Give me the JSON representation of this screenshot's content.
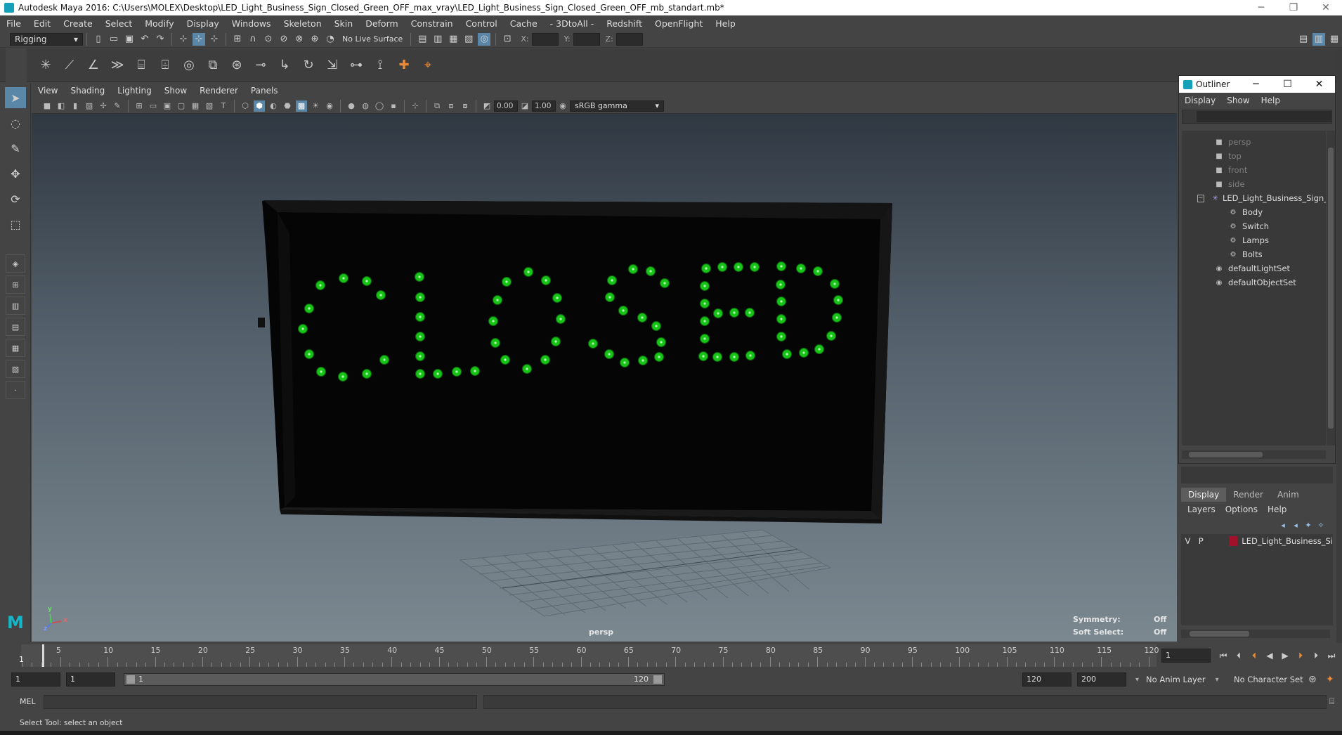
{
  "window": {
    "title": "Autodesk Maya 2016: C:\\Users\\MOLEX\\Desktop\\LED_Light_Business_Sign_Closed_Green_OFF_max_vray\\LED_Light_Business_Sign_Closed_Green_OFF_mb_standart.mb*",
    "minimize": "─",
    "restore": "❐",
    "close": "✕"
  },
  "menubar": [
    "File",
    "Edit",
    "Create",
    "Select",
    "Modify",
    "Display",
    "Windows",
    "Skeleton",
    "Skin",
    "Deform",
    "Constrain",
    "Control",
    "Cache",
    "- 3DtoAll -",
    "Redshift",
    "OpenFlight",
    "Help"
  ],
  "statusline": {
    "menuset": "Rigging",
    "live_surface": "No Live Surface",
    "x_label": "X:",
    "y_label": "Y:",
    "z_label": "Z:"
  },
  "panel": {
    "menus": [
      "View",
      "Shading",
      "Lighting",
      "Show",
      "Renderer",
      "Panels"
    ],
    "exposure": "0.00",
    "gamma": "1.00",
    "color_space": "sRGB gamma"
  },
  "viewport": {
    "camera_label": "persp",
    "symmetry_label": "Symmetry:",
    "symmetry_value": "Off",
    "soft_select_label": "Soft Select:",
    "soft_select_value": "Off",
    "axis_x": "x",
    "axis_y": "y",
    "axis_z": "z",
    "led_color": "#19c419"
  },
  "outliner": {
    "title": "Outliner",
    "menus": [
      "Display",
      "Show",
      "Help"
    ],
    "search_placeholder": "",
    "items": [
      {
        "label": "persp",
        "dim": true
      },
      {
        "label": "top",
        "dim": true
      },
      {
        "label": "front",
        "dim": true
      },
      {
        "label": "side",
        "dim": true
      },
      {
        "label": "LED_Light_Business_Sign_Cl"
      },
      {
        "label": "Body"
      },
      {
        "label": "Switch"
      },
      {
        "label": "Lamps"
      },
      {
        "label": "Bolts"
      },
      {
        "label": "defaultLightSet"
      },
      {
        "label": "defaultObjectSet"
      }
    ]
  },
  "layers": {
    "tabs": [
      "Display",
      "Render",
      "Anim"
    ],
    "menus": [
      "Layers",
      "Options",
      "Help"
    ],
    "row": {
      "v": "V",
      "p": "P",
      "name": "LED_Light_Business_Si",
      "color": "#a1122a"
    }
  },
  "timeline": {
    "ticks": [
      5,
      10,
      15,
      20,
      25,
      30,
      35,
      40,
      45,
      50,
      55,
      60,
      65,
      70,
      75,
      80,
      85,
      90,
      95,
      100,
      105,
      110,
      115,
      120
    ],
    "current_frame": "1",
    "current_frame_field": "1"
  },
  "range": {
    "start_field": "1",
    "playback_start": "1",
    "slider_start": "1",
    "slider_end": "120",
    "playback_end": "120",
    "end_field": "200",
    "anim_layer": "No Anim Layer",
    "character_set": "No Character Set"
  },
  "command": {
    "mel_label": "MEL"
  },
  "help_line": "Select Tool: select an object"
}
